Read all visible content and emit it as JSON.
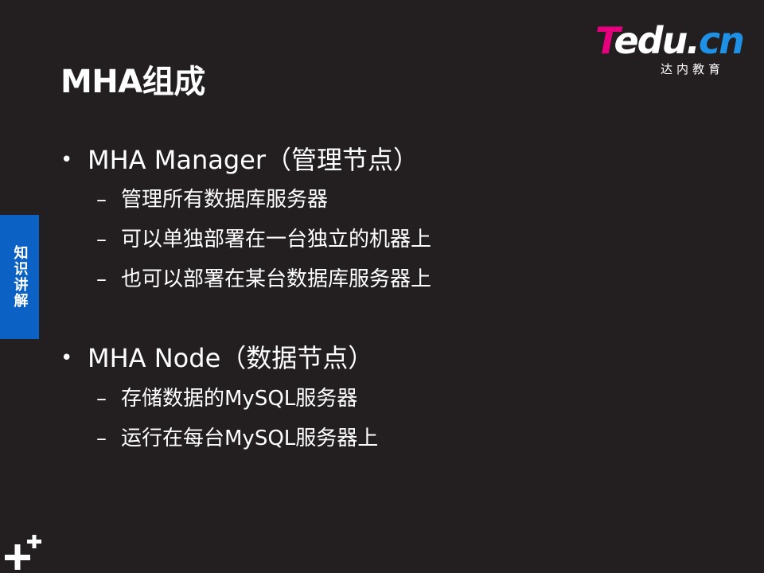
{
  "slide": {
    "title": "MHA组成",
    "logo": {
      "brand_t": "T",
      "brand_rest": "edu.",
      "brand_cn": "cn",
      "subtitle": "达内教育"
    },
    "side_tab": "知识讲解",
    "sections": [
      {
        "bullet": "MHA  Manager（管理节点）",
        "items": [
          "管理所有数据库服务器",
          "可以单独部署在一台独立的机器上",
          "也可以部署在某台数据库服务器上"
        ]
      },
      {
        "bullet": "MHA  Node（数据节点）",
        "items": [
          "存储数据的MySQL服务器",
          "运行在每台MySQL服务器上"
        ]
      }
    ],
    "bullet_symbol": "•",
    "sub_symbol": "–",
    "colors": {
      "background": "#231f20",
      "accent_blue": "#0b62c4",
      "brand_pink": "#e6007e",
      "brand_blue": "#1e90e6"
    }
  }
}
